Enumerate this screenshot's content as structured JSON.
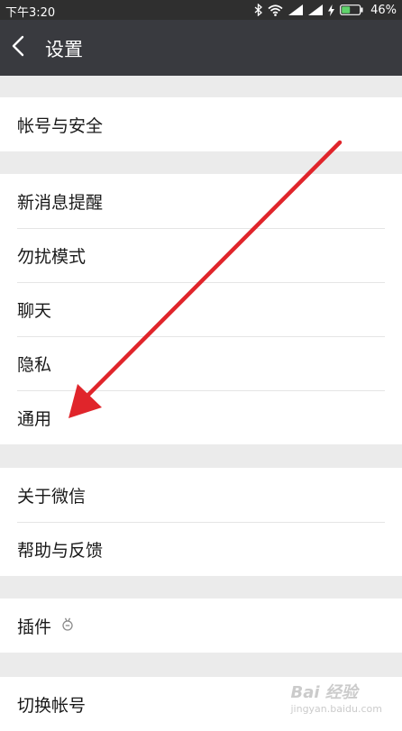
{
  "status_bar": {
    "time": "下午3:20",
    "battery_percent": "46%",
    "icons": [
      "bluetooth-icon",
      "wifi-icon",
      "signal-icon",
      "signal-icon",
      "charging-icon",
      "battery-icon"
    ]
  },
  "header": {
    "title": "设置",
    "back_icon": "chevron-left-icon"
  },
  "groups": [
    {
      "items": [
        {
          "label": "帐号与安全"
        }
      ]
    },
    {
      "items": [
        {
          "label": "新消息提醒"
        },
        {
          "label": "勿扰模式"
        },
        {
          "label": "聊天"
        },
        {
          "label": "隐私"
        },
        {
          "label": "通用"
        }
      ]
    },
    {
      "items": [
        {
          "label": "关于微信"
        },
        {
          "label": "帮助与反馈"
        }
      ]
    },
    {
      "items": [
        {
          "label": "插件",
          "icon": "plugin-icon"
        }
      ]
    },
    {
      "items": [
        {
          "label": "切换帐号"
        }
      ]
    }
  ],
  "watermark": {
    "text": "Bai 经验",
    "sub": "jingyan.baidu.com"
  },
  "colors": {
    "status_bar": "#2f2f2f",
    "title_bar": "#393a3f",
    "background": "#ebebeb",
    "annotation_arrow": "#e0252b",
    "battery_fill": "#5fd36b"
  }
}
